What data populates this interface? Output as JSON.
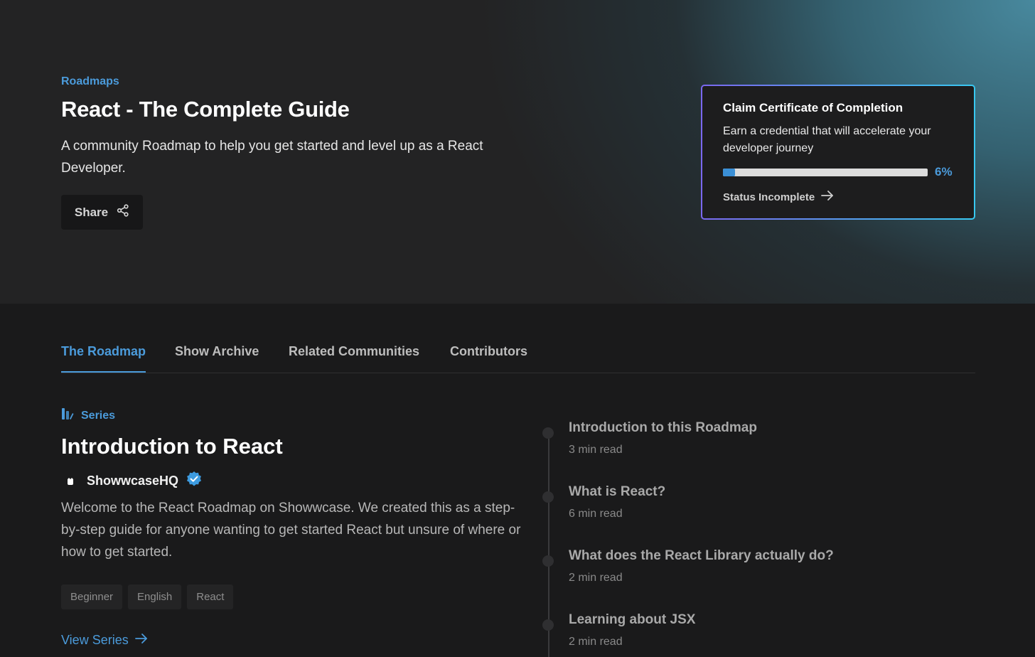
{
  "hero": {
    "breadcrumb": "Roadmaps",
    "title": "React - The Complete Guide",
    "description": "A community Roadmap to help you get started and level up as a React Developer.",
    "share_label": "Share"
  },
  "certificate": {
    "title": "Claim Certificate of Completion",
    "description": "Earn a credential that will accelerate your developer journey",
    "progress_percent": 6,
    "progress_label": "6%",
    "status_label": "Status Incomplete"
  },
  "tabs": [
    {
      "label": "The Roadmap",
      "active": true
    },
    {
      "label": "Show Archive",
      "active": false
    },
    {
      "label": "Related Communities",
      "active": false
    },
    {
      "label": "Contributors",
      "active": false
    }
  ],
  "series": {
    "label": "Series",
    "title": "Introduction to React",
    "author": "ShowwcaseHQ",
    "description": "Welcome to the React Roadmap on Showwcase. We created this as a step-by-step guide for anyone wanting to get started React but unsure of where or how to get started.",
    "tags": [
      "Beginner",
      "English",
      "React"
    ],
    "view_label": "View Series"
  },
  "timeline": [
    {
      "title": "Introduction to this Roadmap",
      "meta": "3 min read"
    },
    {
      "title": "What is React?",
      "meta": "6 min read"
    },
    {
      "title": "What does the React Library actually do?",
      "meta": "2 min read"
    },
    {
      "title": "Learning about JSX",
      "meta": "2 min read"
    }
  ],
  "colors": {
    "accent": "#4b9bdb",
    "background": "#1a1a1b",
    "card_border_start": "#7b68f0",
    "card_border_end": "#38c8f0"
  },
  "icons": {
    "share": "share-icon",
    "arrow": "arrow-right-icon",
    "series": "series-icon",
    "verified": "verified-badge-icon"
  }
}
